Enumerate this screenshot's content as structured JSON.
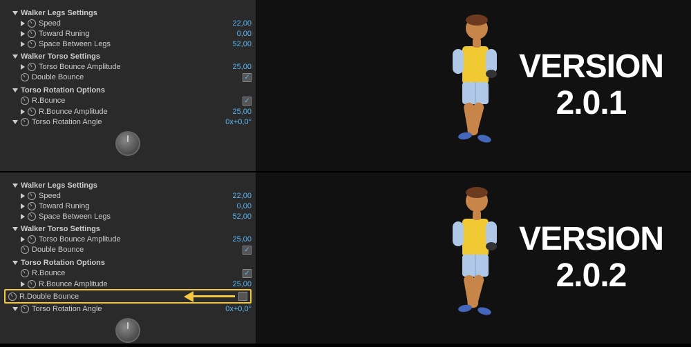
{
  "panel1": {
    "title": "VERSION\n2.0.1",
    "legs_settings": "Walker Legs Settings",
    "speed_label": "Speed",
    "speed_value": "22,00",
    "toward_label": "Toward Runing",
    "toward_value": "0,00",
    "space_label": "Space Between Legs",
    "space_value": "52,00",
    "torso_settings": "Walker Torso Settings",
    "torso_bounce_label": "Torso Bounce Amplitude",
    "torso_bounce_value": "25,00",
    "double_bounce_label": "Double Bounce",
    "torso_rotation_label": "Torso Rotation Options",
    "rbounce_label": "R.Bounce",
    "rbounce_amp_label": "R.Bounce Amplitude",
    "rbounce_amp_value": "25,00",
    "torso_angle_label": "Torso Rotation Angle",
    "torso_angle_value": "0x+0,0°"
  },
  "panel2": {
    "title": "VERSION\n2.0.2",
    "legs_settings": "Walker Legs Settings",
    "speed_label": "Speed",
    "speed_value": "22,00",
    "toward_label": "Toward Runing",
    "toward_value": "0,00",
    "space_label": "Space Between Legs",
    "space_value": "52,00",
    "torso_settings": "Walker Torso Settings",
    "torso_bounce_label": "Torso Bounce Amplitude",
    "torso_bounce_value": "25,00",
    "double_bounce_label": "Double Bounce",
    "torso_rotation_label": "Torso Rotation Options",
    "rbounce_label": "R.Bounce",
    "rbounce_amp_label": "R.Bounce Amplitude",
    "rbounce_amp_value": "25,00",
    "rdouble_bounce_label": "R.Double Bounce",
    "torso_angle_label": "Torso Rotation Angle",
    "torso_angle_value": "0x+0,0°"
  }
}
